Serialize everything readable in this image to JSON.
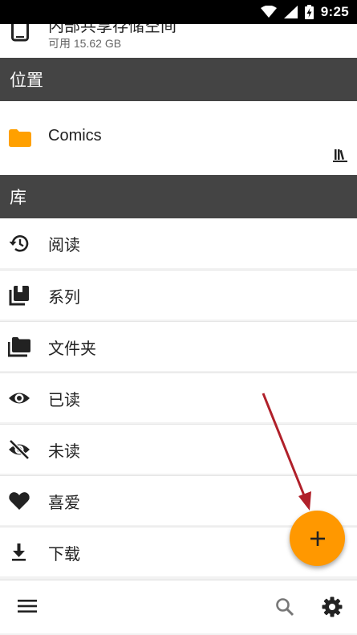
{
  "status_bar": {
    "time": "9:25"
  },
  "storage": {
    "name": "内部共享存储空间",
    "free": "可用 15.62 GB"
  },
  "sections": {
    "locations": "位置",
    "library": "库"
  },
  "locations": [
    {
      "label": "Comics",
      "icon": "folder-icon"
    }
  ],
  "library": [
    {
      "label": "阅读",
      "icon": "history-icon"
    },
    {
      "label": "系列",
      "icon": "series-icon"
    },
    {
      "label": "文件夹",
      "icon": "folders-icon"
    },
    {
      "label": "已读",
      "icon": "eye-icon"
    },
    {
      "label": "未读",
      "icon": "eye-off-icon"
    },
    {
      "label": "喜爱",
      "icon": "heart-icon"
    },
    {
      "label": "下载",
      "icon": "download-icon"
    }
  ],
  "bottom_bar": {
    "icons": [
      "menu-icon",
      "search-icon",
      "gear-icon"
    ]
  },
  "fab": {
    "icon": "plus-icon"
  },
  "colors": {
    "accent": "#ff9800",
    "header": "#444444",
    "folder": "#ffa000",
    "annotation": "#b0202a"
  }
}
